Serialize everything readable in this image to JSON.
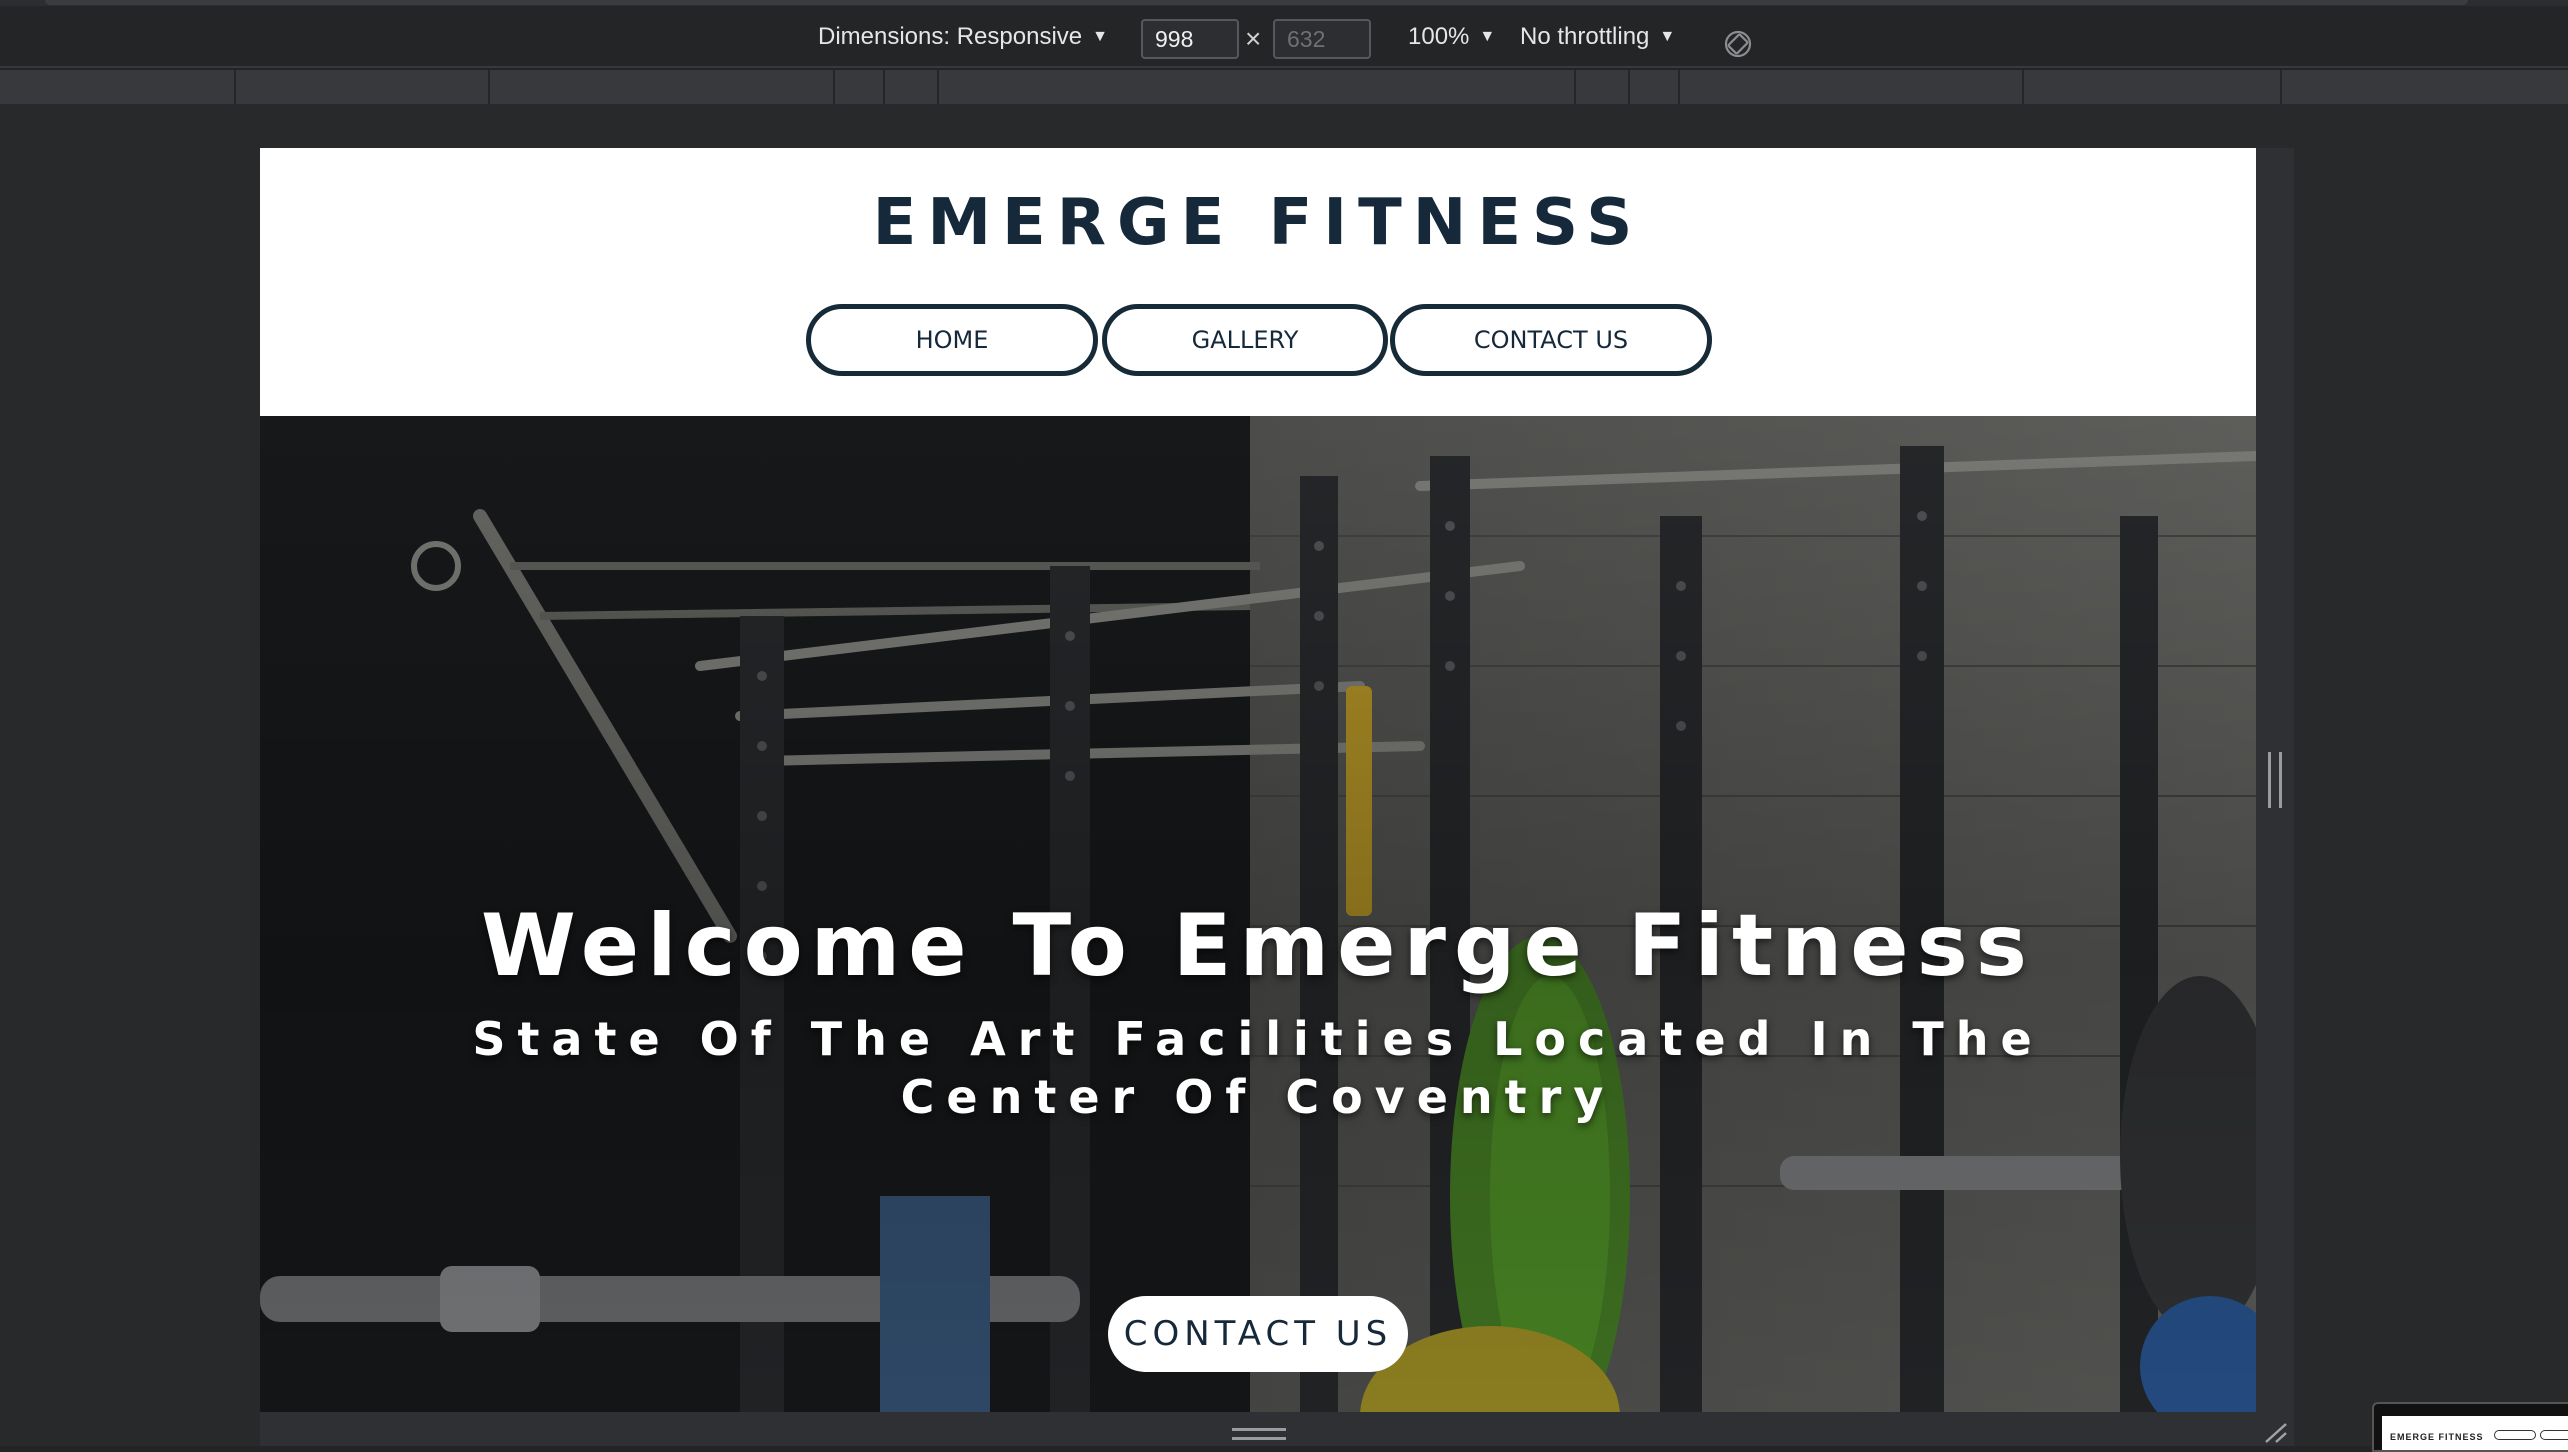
{
  "devtools": {
    "dimensions_label": "Dimensions: Responsive",
    "width_value": "998",
    "height_placeholder": "632",
    "times": "×",
    "zoom": "100%",
    "throttling": "No throttling",
    "rotate_icon": "rotate-icon",
    "colors": {
      "toolbar_bg": "#232527",
      "ruler_bg": "#37393c",
      "frame_bg": "#27292b"
    }
  },
  "site": {
    "title": "EMERGE FITNESS",
    "nav": [
      {
        "label": "HOME"
      },
      {
        "label": "GALLERY"
      },
      {
        "label": "CONTACT US"
      }
    ],
    "hero": {
      "title": "Welcome To Emerge Fitness",
      "subtitle": "State Of The Art Facilities Located In The Center Of Coventry",
      "cta_label": "CONTACT US"
    },
    "colors": {
      "brand": "#15293a",
      "nav_border": "#162a37",
      "hero_text": "#ffffff",
      "cta_bg": "#ffffff",
      "plate_green": "#5aa52c",
      "plate_yellow": "#d8c22e"
    }
  },
  "thumbnail": {
    "title": "EMERGE FITNESS"
  }
}
